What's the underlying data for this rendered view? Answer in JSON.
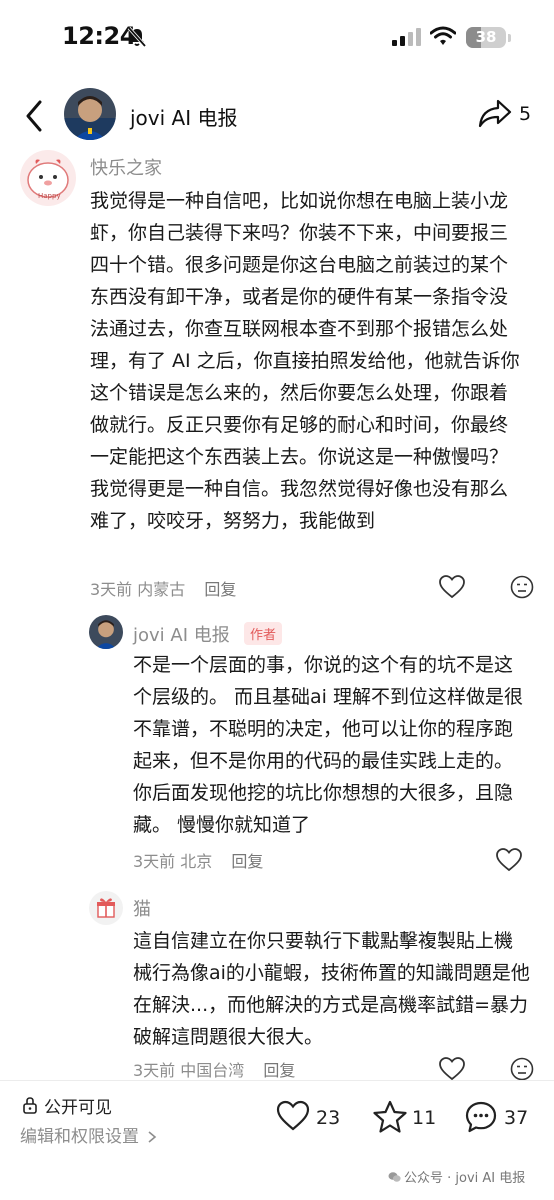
{
  "status_bar": {
    "time": "12:24",
    "battery": "38",
    "battery_level": 0.38
  },
  "header": {
    "title": "jovi AI 电报",
    "share_count": "5"
  },
  "comments": [
    {
      "username": "快乐之家",
      "text": "我觉得是一种自信吧，比如说你想在电脑上装小龙虾，你自己装得下来吗？你装不下来，中间要报三四十个错。很多问题是你这台电脑之前装过的某个东西没有卸干净，或者是你的硬件有某一条指令没法通过去，你查互联网根本查不到那个报错怎么处理，有了 AI 之后，你直接拍照发给他，他就告诉你这个错误是怎么来的，然后你要怎么处理，你跟着做就行。反正只要你有足够的耐心和时间，你最终一定能把这个东西装上去。你说这是一种傲慢吗？我觉得更是一种自信。我忽然觉得好像也没有那么难了，咬咬牙，努努力，我能做到",
      "time": "3天前",
      "location": "内蒙古",
      "reply_label": "回复"
    },
    {
      "username": "jovi AI 电报",
      "badge": "作者",
      "text": "不是一个层面的事，你说的这个有的坑不是这个层级的。 而且基础ai 理解不到位这样做是很不靠谱，不聪明的决定，他可以让你的程序跑起来，但不是你用的代码的最佳实践上走的。 你后面发现他挖的坑比你想想的大很多，且隐藏。 慢慢你就知道了",
      "time": "3天前",
      "location": "北京",
      "reply_label": "回复"
    },
    {
      "username": "猫",
      "text": "這自信建立在你只要執行下載點擊複製貼上機械行為像ai的小龍蝦，技術佈置的知識問題是他在解決...，而他解決的方式是高機率試錯=暴力破解這問題很大很大。",
      "time": "3天前",
      "location": "中国台湾",
      "reply_label": "回复"
    }
  ],
  "bottom_bar": {
    "visibility": "公开可见",
    "settings_label": "编辑和权限设置",
    "like_count": "23",
    "fav_count": "11",
    "comment_count": "37",
    "watermark": "公众号 · jovi AI 电报"
  },
  "colors": {
    "badge": "#e25a5a",
    "badge_bg": "#fde7e7",
    "muted": "#8d8d8d"
  },
  "icons": [
    "back-icon",
    "share-icon",
    "like-icon",
    "dislike-icon",
    "lock-icon",
    "heart-icon",
    "star-icon",
    "comment-icon",
    "gift-icon",
    "bell-muted-icon",
    "wifi-icon",
    "signal-icon"
  ]
}
